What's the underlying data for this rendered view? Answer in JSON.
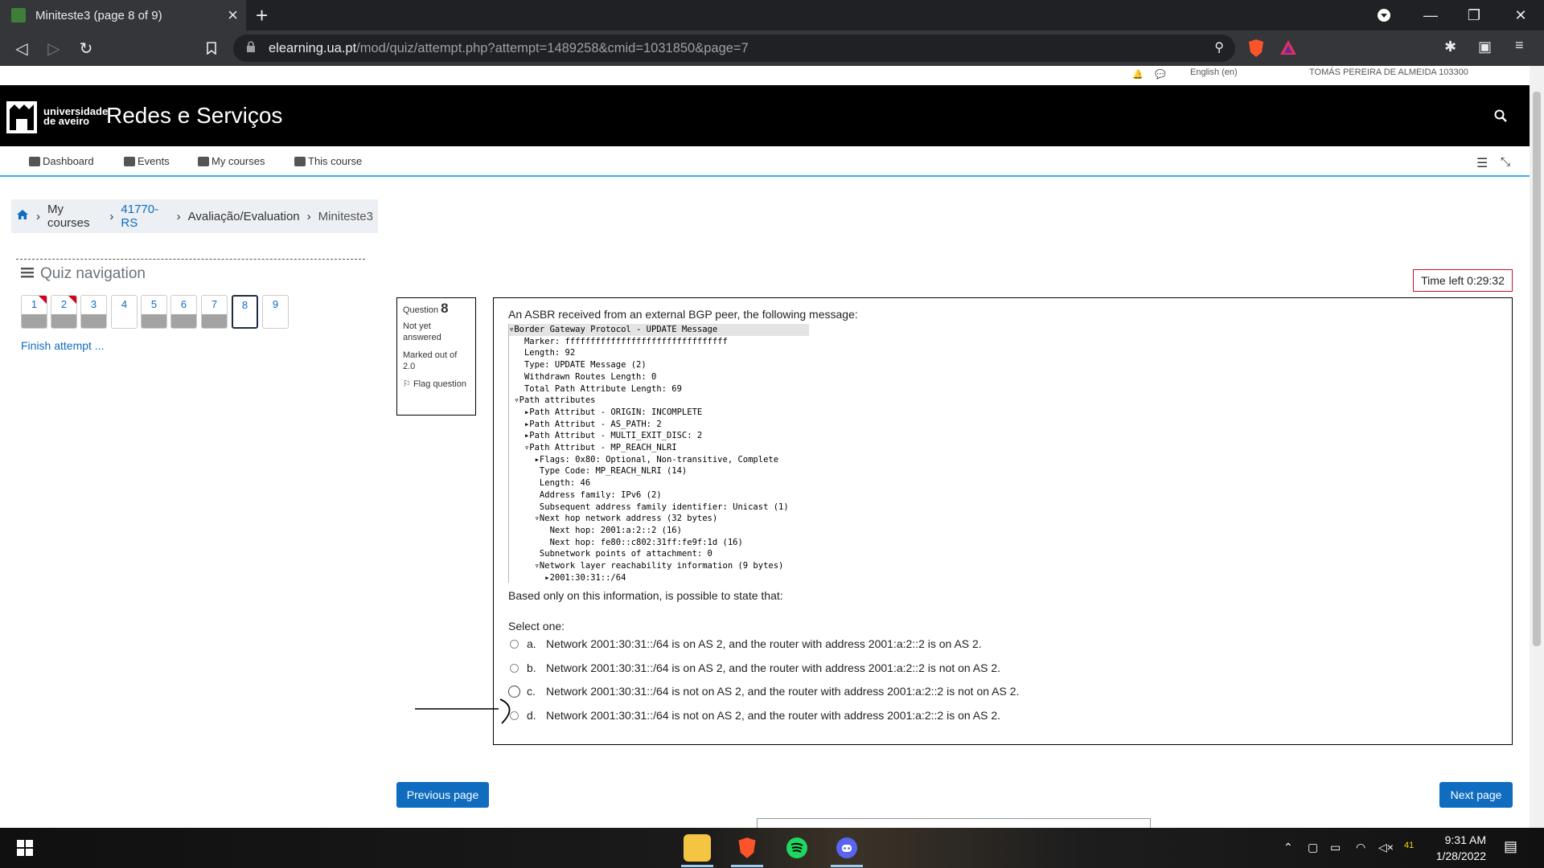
{
  "browser": {
    "tab_title": "Miniteste3 (page 8 of 9)",
    "url_host": "elearning.ua.pt",
    "url_path": "/mod/quiz/attempt.php?attempt=1489258&cmid=1031850&page=7"
  },
  "site": {
    "title": "Redes e Serviços",
    "logo_line1": "universidade",
    "logo_line2": "de aveiro",
    "topstrip_lang": "English (en)",
    "topstrip_user": "TOMÁS PEREIRA DE ALMEIDA 103300"
  },
  "nav": {
    "dashboard": "Dashboard",
    "events": "Events",
    "my_courses": "My courses",
    "this_course": "This course"
  },
  "breadcrumb": {
    "items": [
      "My courses",
      "41770-RS",
      "Avaliação/Evaluation",
      "Miniteste3"
    ]
  },
  "quiz_nav": {
    "title": "Quiz navigation",
    "questions": [
      {
        "label": "1",
        "answered": true,
        "flagged": true
      },
      {
        "label": "2",
        "answered": true,
        "flagged": true
      },
      {
        "label": "3",
        "answered": true,
        "flagged": false
      },
      {
        "label": "4",
        "answered": false,
        "flagged": false
      },
      {
        "label": "5",
        "answered": true,
        "flagged": false
      },
      {
        "label": "6",
        "answered": true,
        "flagged": false
      },
      {
        "label": "7",
        "answered": true,
        "flagged": false
      },
      {
        "label": "8",
        "answered": false,
        "flagged": false,
        "current": true
      },
      {
        "label": "9",
        "answered": false,
        "flagged": false
      }
    ],
    "finish": "Finish attempt ..."
  },
  "question_info": {
    "prefix": "Question",
    "number": "8",
    "state": "Not yet answered",
    "marks": "Marked out of 2.0",
    "flag": "Flag question"
  },
  "timer": "Time left 0:29:32",
  "question": {
    "intro": "An ASBR received from an external BGP peer, the following message:",
    "wireshark": [
      "▿Border Gateway Protocol - UPDATE Message",
      "   Marker: ffffffffffffffffffffffffffffffff",
      "   Length: 92",
      "   Type: UPDATE Message (2)",
      "   Withdrawn Routes Length: 0",
      "   Total Path Attribute Length: 69",
      " ▿Path attributes",
      "   ▸Path Attribut - ORIGIN: INCOMPLETE",
      "   ▸Path Attribut - AS_PATH: 2",
      "   ▸Path Attribut - MULTI_EXIT_DISC: 2",
      "   ▿Path Attribut - MP_REACH_NLRI",
      "     ▸Flags: 0x80: Optional, Non-transitive, Complete",
      "      Type Code: MP_REACH_NLRI (14)",
      "      Length: 46",
      "      Address family: IPv6 (2)",
      "      Subsequent address family identifier: Unicast (1)",
      "     ▿Next hop network address (32 bytes)",
      "        Next hop: 2001:a:2::2 (16)",
      "        Next hop: fe80::c802:31ff:fe9f:1d (16)",
      "      Subnetwork points of attachment: 0",
      "     ▿Network layer reachability information (9 bytes)",
      "       ▸2001:30:31::/64"
    ],
    "prompt": "Based only on this information, is possible to state that:",
    "select_one": "Select one:",
    "options": [
      {
        "letter": "a.",
        "text": "Network 2001:30:31::/64 is on AS 2, and the router with address 2001:a:2::2 is on AS 2."
      },
      {
        "letter": "b.",
        "text": "Network 2001:30:31::/64 is on AS 2, and the router with address 2001:a:2::2 is not on AS 2."
      },
      {
        "letter": "c.",
        "text": "Network 2001:30:31::/64 is not on AS 2, and the router with address 2001:a:2::2 is not on AS 2."
      },
      {
        "letter": "d.",
        "text": "Network 2001:30:31::/64 is not on AS 2, and the router with address 2001:a:2::2 is on AS 2."
      }
    ]
  },
  "buttons": {
    "previous": "Previous page",
    "next": "Next page"
  },
  "taskbar": {
    "time": "9:31 AM",
    "date": "1/28/2022",
    "notif_count": "41"
  },
  "colors": {
    "brand_blue": "#0f6cbf",
    "header_black": "#000000",
    "timer_border": "#c8102e",
    "flag_red": "#d0011b"
  }
}
